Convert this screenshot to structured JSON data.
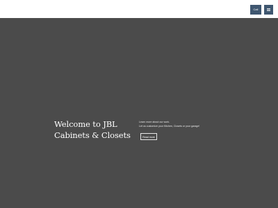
{
  "header": {
    "call_label": "Call",
    "menu_icon": "hamburger-icon"
  },
  "hero": {
    "title": "Welcome to JBL Cabinets & Closets",
    "text_line_1": "Learn more about our work.",
    "text_line_2": "Let us customize your Kitchen, Closets or your garage!",
    "button_label": "Read more"
  },
  "colors": {
    "header_background": "#ffffff",
    "button_background": "#3f5770",
    "hero_background": "#4b4b4b",
    "hero_text": "#ffffff"
  }
}
